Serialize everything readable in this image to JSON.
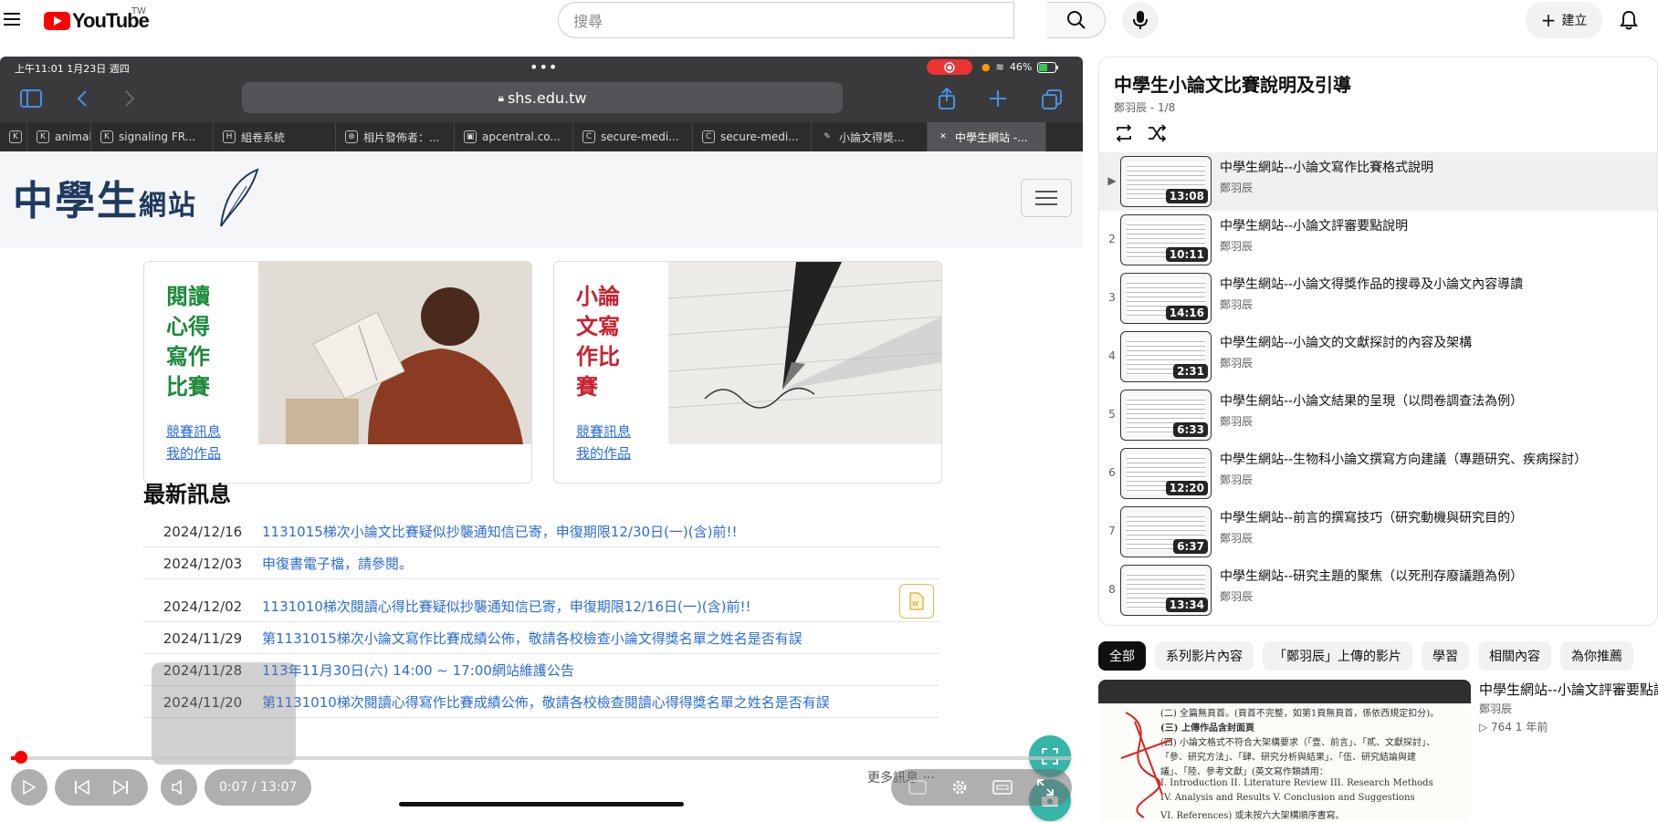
{
  "masthead": {
    "logo_text": "YouTube",
    "country": "TW",
    "search_placeholder": "搜尋",
    "create_label": "建立"
  },
  "ipad": {
    "time": "上午11:01  1月23日 週四",
    "battery": "46%",
    "url": "shs.edu.tw",
    "tabs": [
      {
        "label": "",
        "fav": "K"
      },
      {
        "label": "animal",
        "fav": "K"
      },
      {
        "label": "signaling FR...",
        "fav": "K"
      },
      {
        "label": "組卷系統",
        "fav": "H"
      },
      {
        "label": "相片發佈者：...",
        "fav": "⊛"
      },
      {
        "label": "apcentral.co...",
        "fav": "▣"
      },
      {
        "label": "secure-medi...",
        "fav": "C"
      },
      {
        "label": "secure-medi...",
        "fav": "C"
      },
      {
        "label": "小論文得獎...",
        "fav": "✎"
      },
      {
        "label": "中學生網站 -...",
        "fav": "✕"
      }
    ]
  },
  "site": {
    "logo_main": "中學生",
    "logo_small": "網站",
    "cards": [
      {
        "title": "閱讀心得寫作比賽",
        "color": "#1c8a3a",
        "link1": "競賽訊息",
        "link2": "我的作品"
      },
      {
        "title": "小論文寫作比賽",
        "color": "#c8202f",
        "link1": "競賽訊息",
        "link2": "我的作品"
      }
    ],
    "news_heading": "最新訊息",
    "news": [
      {
        "date": "2024/12/16",
        "text": "1131015梯次小論文比賽疑似抄襲通知信已寄，申復期限12/30日(一)(含)前!!"
      },
      {
        "date": "2024/12/03",
        "text": "申復書電子檔，請參閱。"
      },
      {
        "date": "2024/12/02",
        "text": "1131010梯次閱讀心得比賽疑似抄襲通知信已寄，申復期限12/16日(一)(含)前!!"
      },
      {
        "date": "2024/11/29",
        "text": "第1131015梯次小論文寫作比賽成績公佈，敬請各校檢查小論文得獎名單之姓名是否有誤"
      },
      {
        "date": "2024/11/28",
        "text": "113年11月30日(六) 14:00 ~ 17:00網站維護公告"
      },
      {
        "date": "2024/11/20",
        "text": "第1131010梯次閱讀心得寫作比賽成績公佈，敬請各校檢查閱讀心得得獎名單之姓名是否有誤"
      }
    ]
  },
  "player": {
    "time": "0:07 / 13:07",
    "progress_fraction": 0.009,
    "more_info": "更多訊息 ···"
  },
  "playlist": {
    "title": "中學生小論文比賽說明及引導",
    "subtitle": "鄭羽辰 - 1/8",
    "items": [
      {
        "index": "▶",
        "title": "中學生網站--小論文寫作比賽格式說明",
        "channel": "鄭羽辰",
        "duration": "13:08"
      },
      {
        "index": "2",
        "title": "中學生網站--小論文評審要點說明",
        "channel": "鄭羽辰",
        "duration": "10:11"
      },
      {
        "index": "3",
        "title": "中學生網站--小論文得獎作品的搜尋及小論文內容導讀",
        "channel": "鄭羽辰",
        "duration": "14:16"
      },
      {
        "index": "4",
        "title": "中學生網站--小論文的文獻探討的內容及架構",
        "channel": "鄭羽辰",
        "duration": "2:31"
      },
      {
        "index": "5",
        "title": "中學生網站--小論文結果的呈現（以問卷調查法為例）",
        "channel": "鄭羽辰",
        "duration": "6:33"
      },
      {
        "index": "6",
        "title": "中學生網站--生物科小論文撰寫方向建議（專題研究、疾病探討）",
        "channel": "鄭羽辰",
        "duration": "12:20"
      },
      {
        "index": "7",
        "title": "中學生網站--前言的撰寫技巧（研究動機與研究目的）",
        "channel": "鄭羽辰",
        "duration": "6:37"
      },
      {
        "index": "8",
        "title": "中學生網站--研究主題的聚焦（以死刑存廢議題為例）",
        "channel": "鄭羽辰",
        "duration": "13:34"
      }
    ]
  },
  "chips": [
    "全部",
    "系列影片內容",
    "「鄭羽辰」上傳的影片",
    "學習",
    "相關內容",
    "為你推薦"
  ],
  "related": {
    "title": "中學生網站--小論文評審要點說明",
    "channel": "鄭羽辰",
    "meta": "▷ 764  1 年前",
    "thumb_lines": [
      "(二) 全篇無頁首。(頁首不完整，如第1頁無頁首，係依西規定扣分)。",
      "(三) 上傳作品含封面頁",
      "(四) 小論文格式不符合大架構要求（「壹、前言」、「貳、文獻探討」、",
      "「參、研究方法」、「肆、研究分析與結果」、「伍、研究結論與建",
      "議」、「陸、參考文獻」(英文寫作類請用：",
      "I. Introduction   II. Literature Review   III. Research Methods",
      "IV. Analysis and Results   V. Conclusion and Suggestions",
      "VI. References) 或未按六大架構順序書寫。"
    ]
  }
}
